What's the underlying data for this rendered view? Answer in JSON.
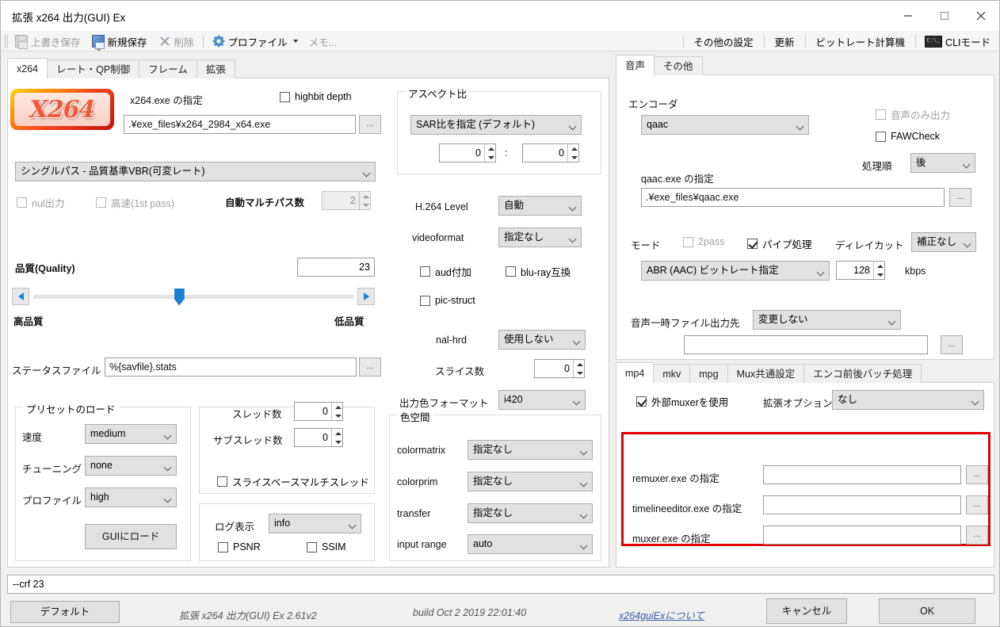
{
  "window": {
    "title": "拡張 x264 出力(GUI) Ex",
    "minimize": "−",
    "maximize": "□",
    "close": "✕"
  },
  "toolbar": {
    "save_overwrite": "上書き保存",
    "save_new": "新規保存",
    "delete": "削除",
    "profile": "プロファイル",
    "memo": "メモ...",
    "other_settings": "その他の設定",
    "update": "更新",
    "bitrate_calc": "ビットレート計算機",
    "cli_mode": "CLIモード",
    "cli_icon_text": "C:\\_"
  },
  "main_tabs": [
    {
      "label": "x264",
      "active": true
    },
    {
      "label": "レート・QP制御",
      "active": false
    },
    {
      "label": "フレーム",
      "active": false
    },
    {
      "label": "拡張",
      "active": false
    }
  ],
  "x264_tab": {
    "logo_text": "X264",
    "exe_label": "x264.exe の指定",
    "exe_value": ".¥exe_files¥x264_2984_x64.exe",
    "highbit_depth": {
      "label": "highbit depth",
      "checked": false
    },
    "browse": "...",
    "mode_value": "シングルパス - 品質基準VBR(可変レート)",
    "nul_output": {
      "label": "nul出力",
      "checked": false
    },
    "fast_1st_pass": {
      "label": "高速(1st pass)",
      "checked": false
    },
    "auto_multipass_label": "自動マルチパス数",
    "auto_multipass_value": "2",
    "quality_label": "品質(Quality)",
    "quality_value": "23",
    "high_quality": "高品質",
    "low_quality": "低品質",
    "status_file_label": "ステータスファイル",
    "status_file_value": "%{savfile}.stats",
    "preset_group": "プリセットのロード",
    "speed_label": "速度",
    "speed_value": "medium",
    "tuning_label": "チューニング",
    "tuning_value": "none",
    "profile_label": "プロファイル",
    "profile_value": "high",
    "load_gui_button": "GUIにロード",
    "threads_label": "スレッド数",
    "threads_value": "0",
    "subthreads_label": "サブスレッド数",
    "subthreads_value": "0",
    "slice_based_mt": {
      "label": "スライスベースマルチスレッド",
      "checked": false
    },
    "log_label": "ログ表示",
    "log_value": "info",
    "psnr": {
      "label": "PSNR",
      "checked": false
    },
    "ssim": {
      "label": "SSIM",
      "checked": false
    },
    "aspect_group": "アスペクト比",
    "aspect_value": "SAR比を指定 (デフォルト)",
    "aspect_num": "0",
    "aspect_sep": ":",
    "aspect_den": "0",
    "level_label": "H.264 Level",
    "level_value": "自動",
    "videoformat_label": "videoformat",
    "videoformat_value": "指定なし",
    "aud": {
      "label": "aud付加",
      "checked": false
    },
    "bluray": {
      "label": "blu-ray互換",
      "checked": false
    },
    "pic_struct": {
      "label": "pic-struct",
      "checked": false
    },
    "nal_hrd_label": "nal-hrd",
    "nal_hrd_value": "使用しない",
    "slices_label": "スライス数",
    "slices_value": "0",
    "out_colorfmt_label": "出力色フォーマット",
    "out_colorfmt_value": "i420",
    "colorspace_group": "色空間",
    "colormatrix_label": "colormatrix",
    "colormatrix_value": "指定なし",
    "colorprim_label": "colorprim",
    "colorprim_value": "指定なし",
    "transfer_label": "transfer",
    "transfer_value": "指定なし",
    "input_range_label": "input range",
    "input_range_value": "auto"
  },
  "audio": {
    "tabs": [
      {
        "label": "音声",
        "active": true
      },
      {
        "label": "その他",
        "active": false
      }
    ],
    "encoder_label": "エンコーダ",
    "encoder_value": "qaac",
    "audio_only": {
      "label": "音声のみ出力",
      "checked": false
    },
    "fawcheck": {
      "label": "FAWCheck",
      "checked": false
    },
    "order_label": "処理順",
    "order_value": "後",
    "exe_label": "qaac.exe の指定",
    "exe_value": ".¥exe_files¥qaac.exe",
    "browse": "...",
    "mode_label": "モード",
    "twopass": {
      "label": "2pass",
      "checked": false
    },
    "pipe": {
      "label": "パイプ処理",
      "checked": true
    },
    "delaycut_label": "ディレイカット",
    "delaycut_value": "補正なし",
    "bitrate_mode_value": "ABR (AAC) ビットレート指定",
    "bitrate_value": "128",
    "bitrate_unit": "kbps",
    "temp_dir_label": "音声一時ファイル出力先",
    "temp_dir_value": "変更しない",
    "temp_path_value": ""
  },
  "mux": {
    "tabs": [
      {
        "label": "mp4",
        "active": true
      },
      {
        "label": "mkv",
        "active": false
      },
      {
        "label": "mpg",
        "active": false
      },
      {
        "label": "Mux共通設定",
        "active": false
      },
      {
        "label": "エンコ前後バッチ処理",
        "active": false
      }
    ],
    "use_external": {
      "label": "外部muxerを使用",
      "checked": true
    },
    "ext_option_label": "拡張オプション",
    "ext_option_value": "なし",
    "browse": "...",
    "rows": [
      {
        "label": "remuxer.exe の指定",
        "value": ""
      },
      {
        "label": "timelineeditor.exe の指定",
        "value": ""
      },
      {
        "label": "muxer.exe の指定",
        "value": ""
      }
    ],
    "highlight_color": "#e00000"
  },
  "footer": {
    "command_line": "--crf 23",
    "default_button": "デフォルト",
    "version": "拡張 x264 出力(GUI) Ex 2.61v2",
    "build": "build Oct  2 2019 22:01:40",
    "about_link": "x264guiExについて",
    "cancel_button": "キャンセル",
    "ok_button": "OK"
  }
}
